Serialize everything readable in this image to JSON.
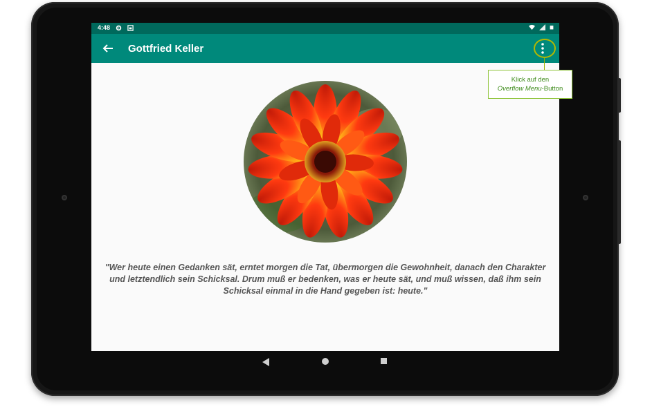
{
  "status_bar": {
    "time": "4:48",
    "icons": [
      "gear-icon",
      "screenshot-icon",
      "wifi-icon",
      "signal-icon",
      "battery-icon"
    ]
  },
  "app_bar": {
    "title": "Gottfried Keller",
    "back_icon": "arrow-back-icon",
    "overflow_icon": "more-vert-icon",
    "background": "#00897b",
    "status_background": "#00695c"
  },
  "content": {
    "image_subject": "flower-photo",
    "quote": "\"Wer heute einen Gedanken sät, erntet morgen die Tat, übermorgen die Gewohnheit, danach den Charakter und letztendlich sein Schicksal. Drum muß er bedenken, was er heute sät, und muß wissen, daß ihm sein Schicksal einmal in die Hand gegeben ist: heute.\""
  },
  "navigation": {
    "back_icon": "nav-back-icon",
    "home_icon": "nav-home-icon",
    "recents_icon": "nav-recents-icon"
  },
  "callout": {
    "line1": "Klick auf den",
    "line2_italic": "Overflow Menu",
    "line2_rest": "-Button",
    "accent": "#8fc43a"
  }
}
